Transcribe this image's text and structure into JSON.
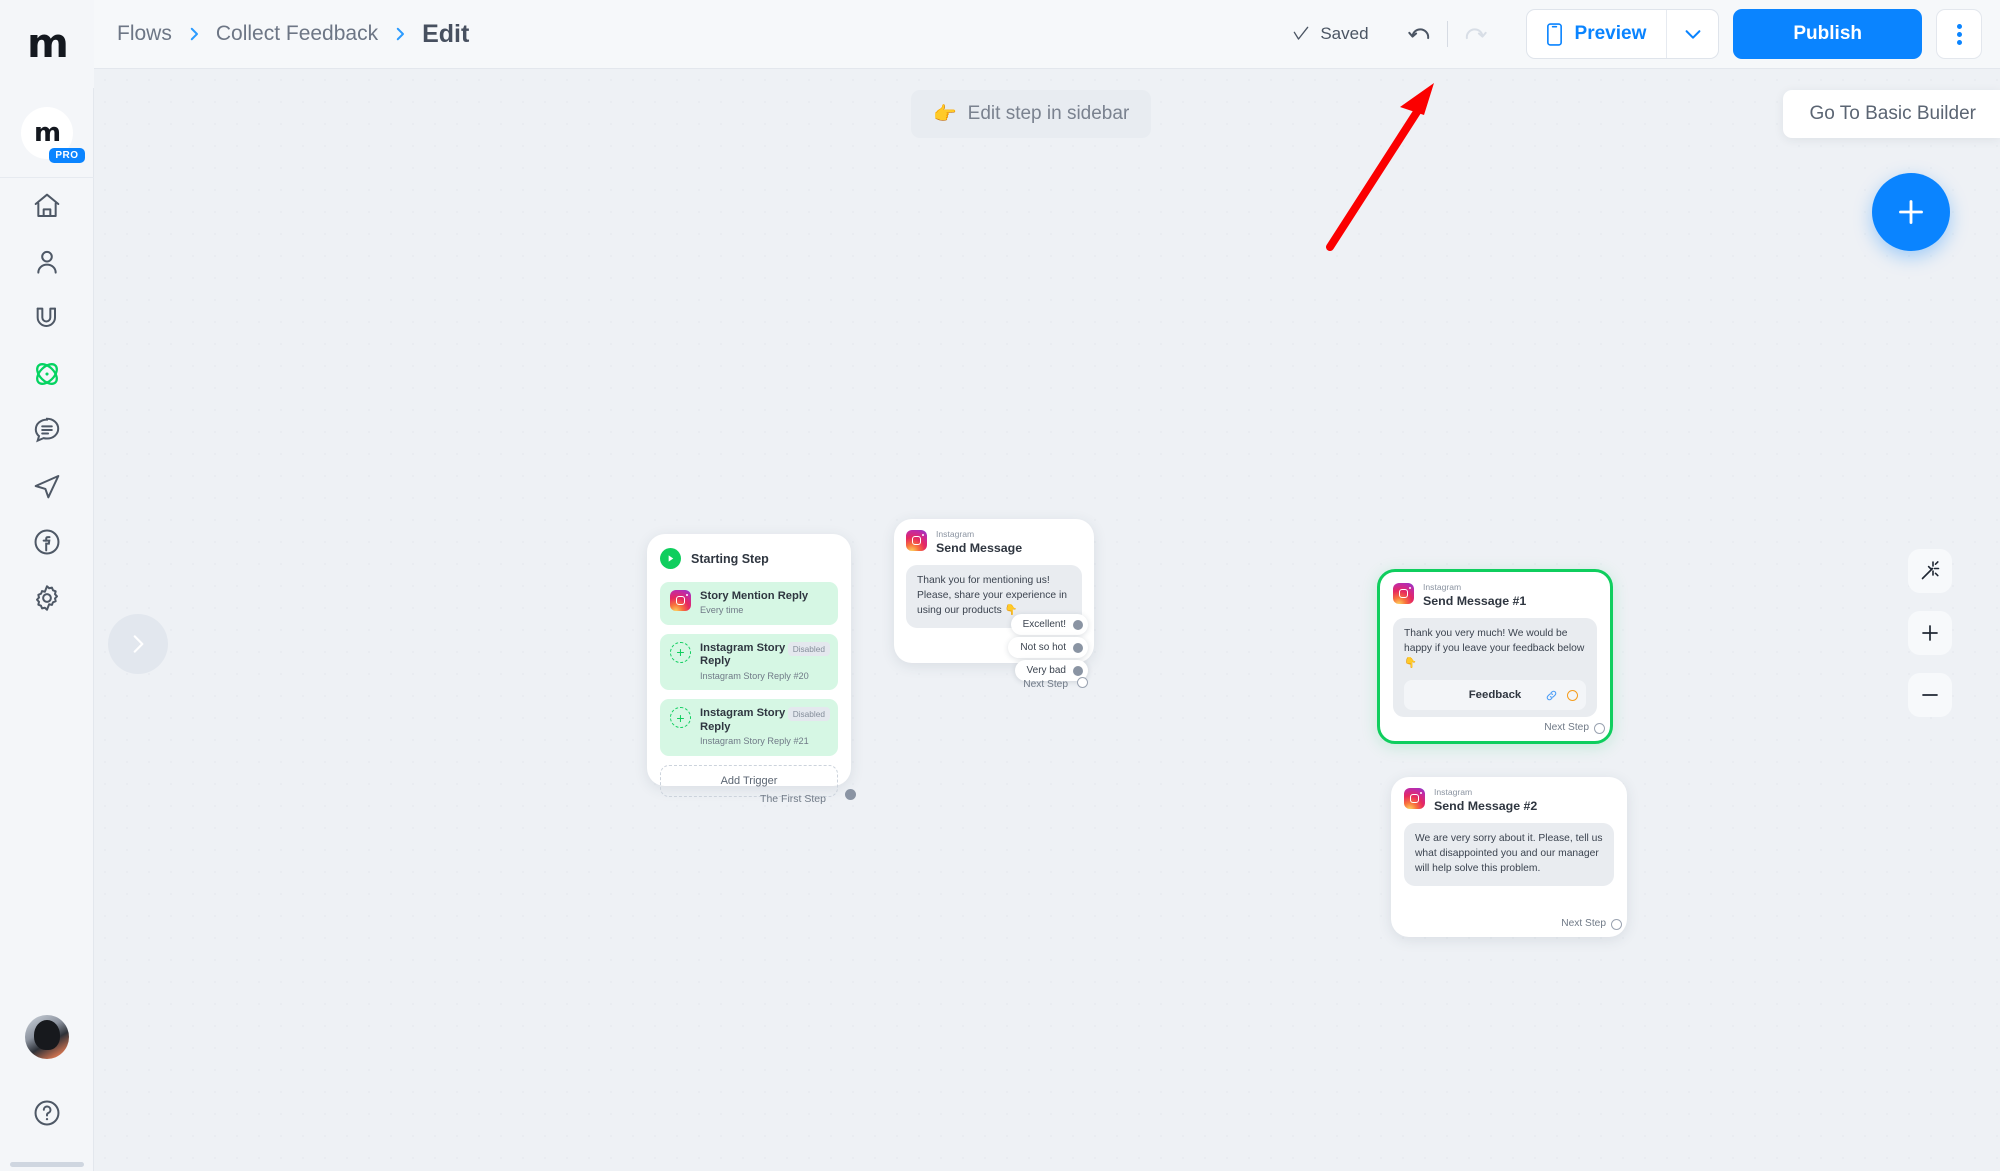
{
  "brand": {
    "logo_text": "m",
    "pro_badge": "PRO",
    "accent": "#0a84ff",
    "green": "#0fce5e"
  },
  "breadcrumb": {
    "items": [
      "Flows",
      "Collect Feedback"
    ],
    "current": "Edit"
  },
  "topbar": {
    "saved_label": "Saved",
    "undo_name": "undo",
    "redo_name": "redo",
    "preview_label": "Preview",
    "publish_label": "Publish",
    "kebab_label": "More options"
  },
  "canvas": {
    "edit_hint": "Edit step in sidebar",
    "edit_hint_emoji": "👉",
    "basic_builder_label": "Go To Basic Builder",
    "add_fab_label": "+",
    "zoom_tools": [
      "auto-layout",
      "zoom-in",
      "zoom-out"
    ],
    "collapse_label": "›"
  },
  "nodes": {
    "start": {
      "title": "Starting Step",
      "triggers": [
        {
          "title": "Story Mention Reply",
          "sub": "Every time",
          "icon": "instagram-icon",
          "badge": ""
        },
        {
          "title": "Instagram Story Reply",
          "sub": "Instagram Story Reply #20",
          "icon": "add-circle-icon",
          "badge": "Disabled"
        },
        {
          "title": "Instagram Story Reply",
          "sub": "Instagram Story Reply #21",
          "icon": "add-circle-icon",
          "badge": "Disabled"
        }
      ],
      "add_trigger_label": "Add Trigger",
      "out_label": "The First Step"
    },
    "send_message": {
      "platform": "Instagram",
      "title": "Send Message",
      "bubble": "Thank you for mentioning us! Please, share your experience in using our products 👇",
      "replies": [
        "Excellent!",
        "Not so hot",
        "Very bad"
      ],
      "next_step_label": "Next Step"
    },
    "message_1": {
      "platform": "Instagram",
      "title": "Send Message #1",
      "bubble": "Thank you very much! We would be happy if you leave your feedback below 👇",
      "button_label": "Feedback",
      "button_icons": [
        "link-icon",
        "ring-icon"
      ],
      "next_step_label": "Next Step",
      "selected": true
    },
    "message_2": {
      "platform": "Instagram",
      "title": "Send Message #2",
      "bubble": "We are very sorry about it. Please, tell us what disappointed you and our manager will help solve this problem.",
      "next_step_label": "Next Step",
      "selected": false
    }
  },
  "sidebar": {
    "items": [
      {
        "name": "home-icon",
        "label": "Home",
        "active": false
      },
      {
        "name": "contacts-icon",
        "label": "Contacts",
        "active": false
      },
      {
        "name": "automation-icon",
        "label": "Automation",
        "active": false
      },
      {
        "name": "flows-icon",
        "label": "Flows",
        "active": true
      },
      {
        "name": "live-chat-icon",
        "label": "Live Chat",
        "active": false
      },
      {
        "name": "broadcast-icon",
        "label": "Broadcast",
        "active": false
      },
      {
        "name": "facebook-icon",
        "label": "Facebook",
        "active": false
      },
      {
        "name": "settings-icon",
        "label": "Settings",
        "active": false
      }
    ],
    "avatar_label": "Account",
    "help_label": "Help"
  },
  "annotation": {
    "type": "red-arrow",
    "color": "#fb0000",
    "points_to": "Preview button"
  }
}
